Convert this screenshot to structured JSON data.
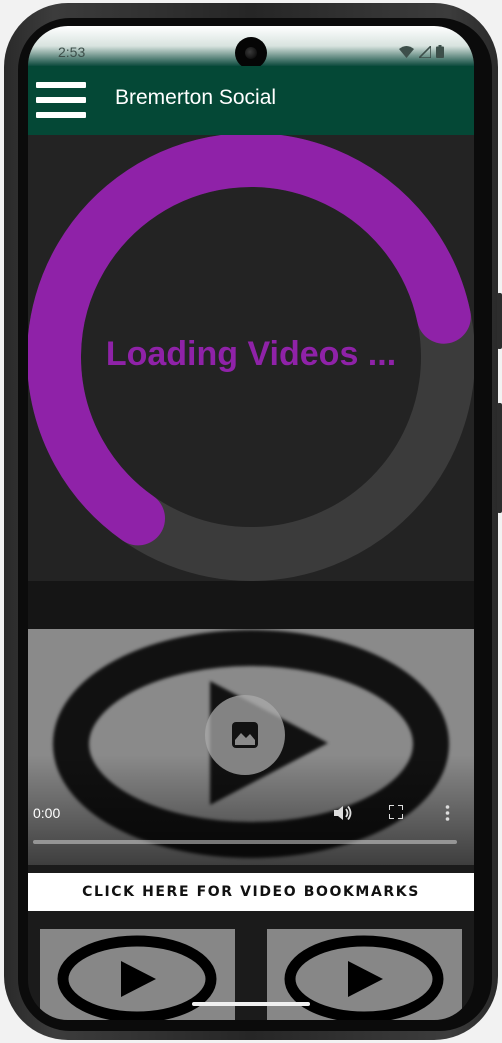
{
  "status_bar": {
    "time": "2:53",
    "icons": [
      "wifi-icon",
      "cell-signal-icon",
      "battery-icon"
    ]
  },
  "app_bar": {
    "title": "Bremerton Social",
    "menu_icon": "hamburger-menu-icon",
    "background_color": "#044836"
  },
  "loading": {
    "text": "Loading Videos ...",
    "accent_color": "#8f22a8",
    "progress_fraction": 0.62
  },
  "video_player": {
    "current_time": "0:00",
    "controls": [
      "volume-icon",
      "fullscreen-icon",
      "more-options-icon"
    ],
    "play_button_icon": "poster-image-icon",
    "progress_fraction": 0
  },
  "bookmarks": {
    "button_label": "CLICK HERE FOR VIDEO BOOKMARKS"
  },
  "thumbnails": [
    {
      "icon": "play-icon"
    },
    {
      "icon": "play-icon"
    }
  ]
}
